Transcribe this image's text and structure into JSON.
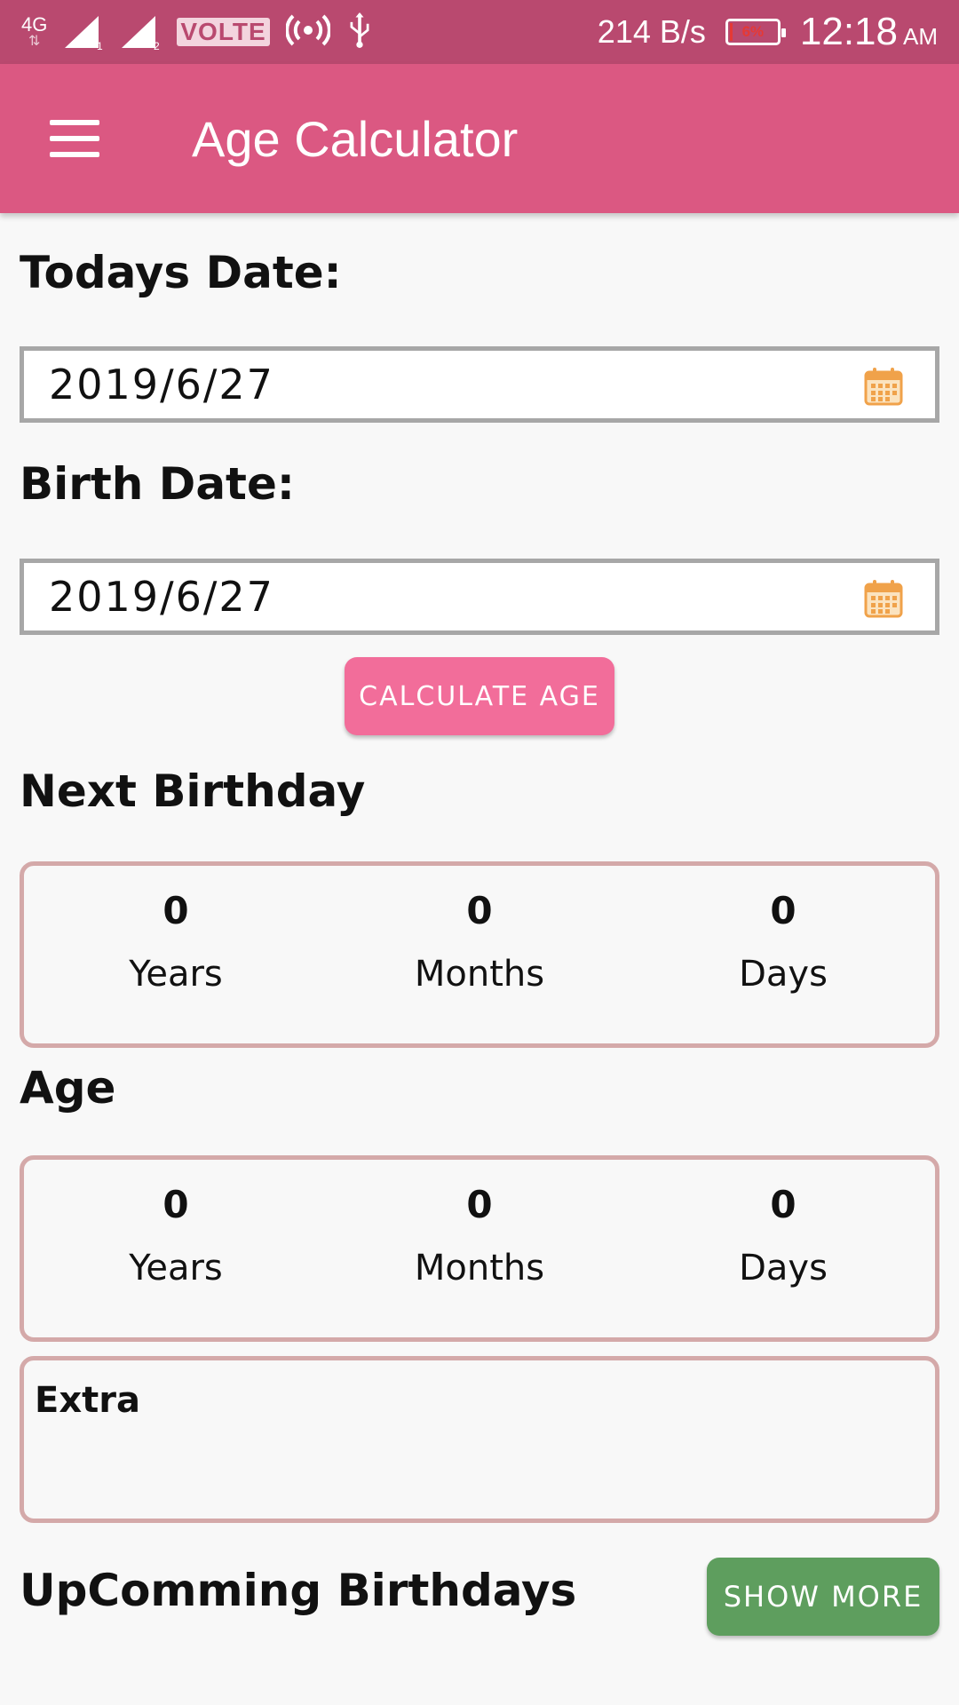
{
  "status_bar": {
    "network": "4G",
    "volte": "VOLTE",
    "speed": "214 B/s",
    "battery": "6%",
    "time": "12:18",
    "ampm": "AM"
  },
  "app_bar": {
    "title": "Age Calculator"
  },
  "todays_date": {
    "label": "Todays Date:",
    "value": "2019/6/27"
  },
  "birth_date": {
    "label": "Birth Date:",
    "value": "2019/6/27"
  },
  "calculate_button": "CALCULATE AGE",
  "next_birthday": {
    "label": "Next Birthday",
    "years": "0",
    "years_label": "Years",
    "months": "0",
    "months_label": "Months",
    "days": "0",
    "days_label": "Days"
  },
  "age": {
    "label": "Age",
    "years": "0",
    "years_label": "Years",
    "months": "0",
    "months_label": "Months",
    "days": "0",
    "days_label": "Days"
  },
  "extra": {
    "label": "Extra"
  },
  "upcoming": {
    "label": "UpComming Birthdays",
    "button": "SHOW MORE"
  },
  "colors": {
    "status_bar": "#b9496f",
    "app_bar": "#db5882",
    "calculate_button": "#f26d9a",
    "show_more_button": "#5e9e5e",
    "card_border": "#d4a9a9"
  }
}
